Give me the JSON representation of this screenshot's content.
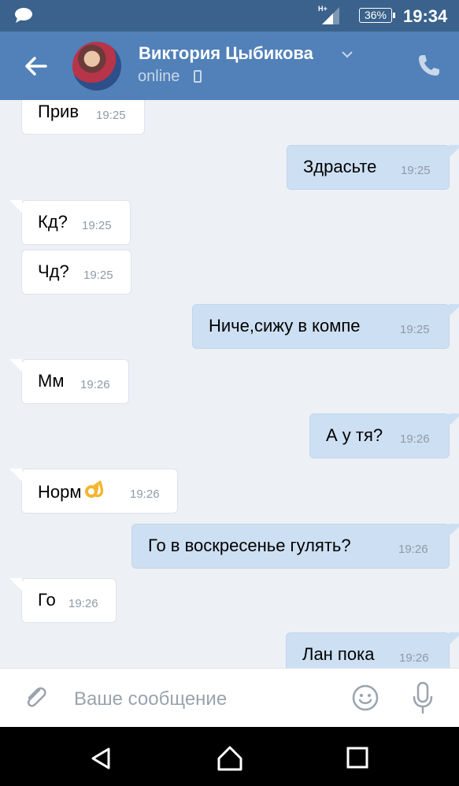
{
  "status_bar": {
    "network": "H+",
    "battery": "36%",
    "time": "19:34"
  },
  "header": {
    "contact_name": "Виктория Цыбикова",
    "status": "online"
  },
  "messages": [
    {
      "dir": "in",
      "text": "Прив",
      "time": "19:25"
    },
    {
      "dir": "out",
      "text": "Здрасьте",
      "time": "19:25"
    },
    {
      "dir": "in",
      "text": "Кд?",
      "time": "19:25"
    },
    {
      "dir": "in",
      "text": "Чд?",
      "time": "19:25"
    },
    {
      "dir": "out",
      "text": "Ниче,сижу в компе",
      "time": "19:25"
    },
    {
      "dir": "in",
      "text": "Мм",
      "time": "19:26"
    },
    {
      "dir": "out",
      "text": "А у тя?",
      "time": "19:26"
    },
    {
      "dir": "in",
      "text": "Норм",
      "emoji": "ok-hand-emoji",
      "time": "19:26"
    },
    {
      "dir": "out",
      "text": "Го в воскресенье гулять?",
      "time": "19:26"
    },
    {
      "dir": "in",
      "text": "Го",
      "time": "19:26"
    },
    {
      "dir": "out",
      "text": "Лан пока",
      "time": "19:26"
    }
  ],
  "composer": {
    "placeholder": "Ваше сообщение"
  },
  "icons": {
    "status": [
      "message-icon",
      "signal-icon",
      "battery-icon"
    ],
    "header": [
      "back-arrow-icon",
      "chevron-down-icon",
      "phone-icon",
      "mobile-device-icon"
    ],
    "composer": [
      "paperclip-icon",
      "smiley-icon",
      "microphone-icon"
    ],
    "navbar": [
      "nav-back-icon",
      "nav-home-icon",
      "nav-recent-icon"
    ]
  },
  "colors": {
    "header_bg": "#5181b8",
    "status_bar_bg": "#3a628c",
    "chat_bg": "#edf0f5",
    "incoming_bubble": "#ffffff",
    "outgoing_bubble": "#cddff2"
  }
}
